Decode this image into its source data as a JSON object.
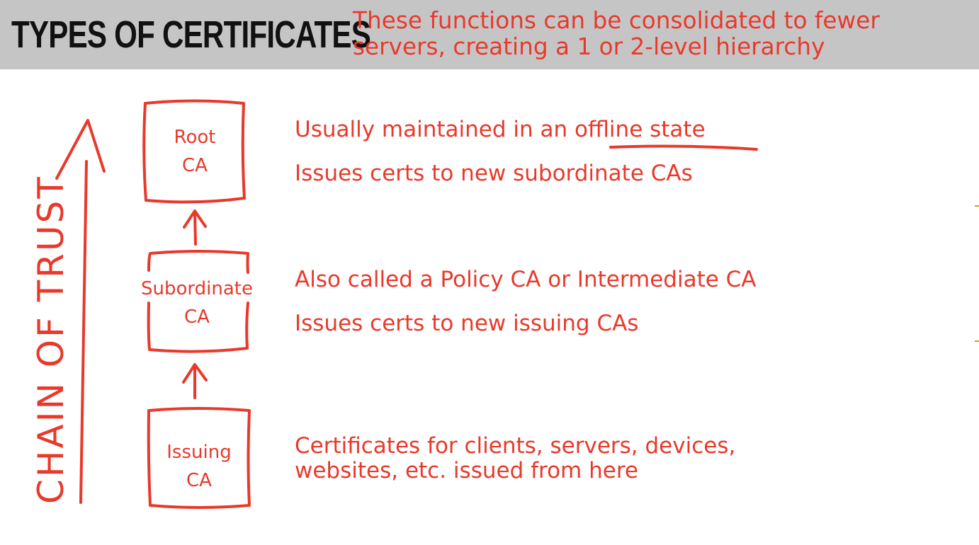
{
  "header": {
    "title": "TYPES OF CERTIFICATES",
    "subtitle_line1": "These functions can be consolidated to fewer",
    "subtitle_line2": "servers, creating a 1 or 2-level hierarchy"
  },
  "chain_label": "CHAIN OF TRUST",
  "nodes": [
    {
      "line1": "Root",
      "line2": "CA"
    },
    {
      "line1": "Subordinate",
      "line2": "CA"
    },
    {
      "line1": "Issuing",
      "line2": "CA"
    }
  ],
  "descriptions": {
    "root": [
      "Usually maintained in an offline state",
      "Issues certs to new subordinate CAs"
    ],
    "subordinate": [
      "Also called a Policy CA or Intermediate CA",
      "Issues certs to new issuing CAs"
    ],
    "issuing": [
      "Certificates for clients, servers, devices,",
      "websites, etc. issued from here"
    ]
  },
  "colors": {
    "accent": "#e8392b",
    "header_bg": "#c6c5c6",
    "title": "#111111"
  }
}
